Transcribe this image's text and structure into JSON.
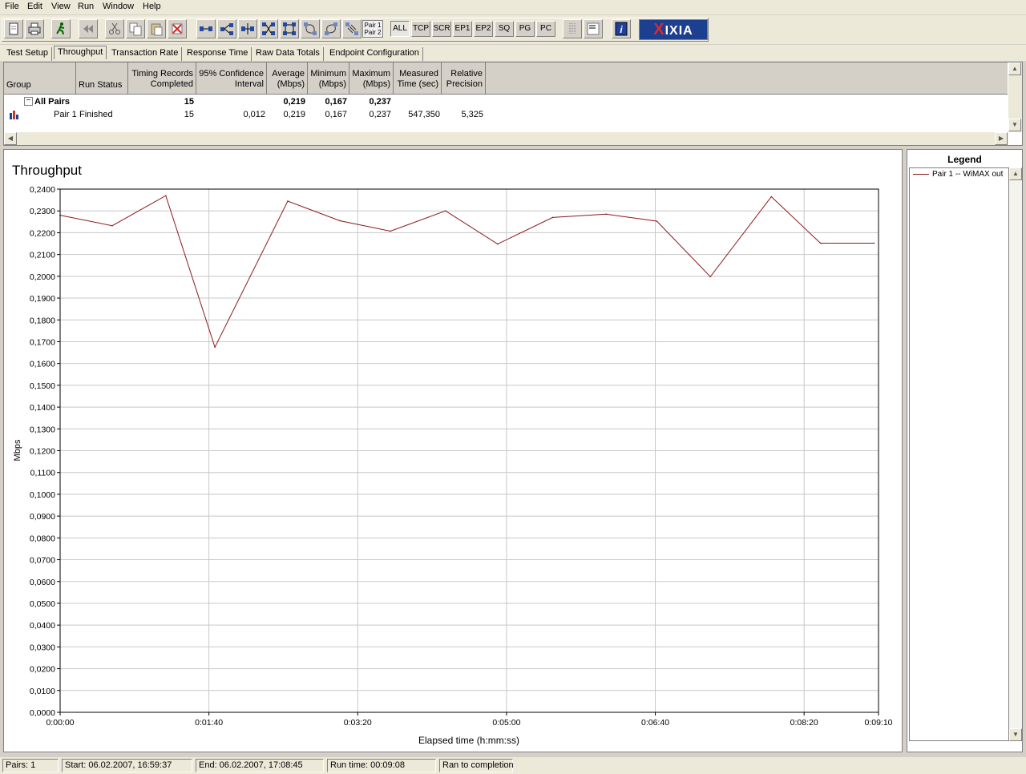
{
  "menu": [
    "File",
    "Edit",
    "View",
    "Run",
    "Window",
    "Help"
  ],
  "toolbar": {
    "text_buttons": [
      "ALL",
      "TCP",
      "SCR",
      "EP1",
      "EP2",
      "SQ",
      "PG",
      "PC"
    ],
    "pair_button": [
      "Pair 1",
      "Pair 2"
    ],
    "logo_text": "IXIA",
    "logo_mark": "X"
  },
  "tabs": [
    "Test Setup",
    "Throughput",
    "Transaction Rate",
    "Response Time",
    "Raw Data Totals",
    "Endpoint Configuration"
  ],
  "active_tab": "Throughput",
  "grid": {
    "headers": [
      {
        "key": "group",
        "label": "Group"
      },
      {
        "key": "run_status",
        "label": "Run Status"
      },
      {
        "key": "records",
        "label": "Timing Records Completed"
      },
      {
        "key": "ci",
        "label": "95% Confidence Interval"
      },
      {
        "key": "avg",
        "label": "Average (Mbps)"
      },
      {
        "key": "min",
        "label": "Minimum (Mbps)"
      },
      {
        "key": "max",
        "label": "Maximum (Mbps)"
      },
      {
        "key": "time",
        "label": "Measured Time (sec)"
      },
      {
        "key": "precision",
        "label": "Relative Precision"
      }
    ],
    "rows": [
      {
        "expander": "−",
        "group": "All Pairs",
        "run_status": "",
        "records": "15",
        "ci": "",
        "avg": "0,219",
        "min": "0,167",
        "max": "0,237",
        "time": "",
        "precision": ""
      },
      {
        "group": "Pair 1",
        "run_status": "Finished",
        "records": "15",
        "ci": "0,012",
        "avg": "0,219",
        "min": "0,167",
        "max": "0,237",
        "time": "547,350",
        "precision": "5,325"
      }
    ]
  },
  "chart_data": {
    "type": "line",
    "title": "Throughput",
    "xlabel": "Elapsed time (h:mm:ss)",
    "ylabel": "Mbps",
    "xlim": [
      0,
      550
    ],
    "ylim": [
      0,
      0.24
    ],
    "grid": true,
    "legend_position": "right panel",
    "x_ticks": [
      {
        "v": 0,
        "label": "0:00:00"
      },
      {
        "v": 100,
        "label": "0:01:40"
      },
      {
        "v": 200,
        "label": "0:03:20"
      },
      {
        "v": 300,
        "label": "0:05:00"
      },
      {
        "v": 400,
        "label": "0:06:40"
      },
      {
        "v": 500,
        "label": "0:08:20"
      },
      {
        "v": 550,
        "label": "0:09:10"
      }
    ],
    "y_ticks": [
      "0,0000",
      "0,0100",
      "0,0200",
      "0,0300",
      "0,0400",
      "0,0500",
      "0,0600",
      "0,0700",
      "0,0800",
      "0,0900",
      "0,1000",
      "0,1100",
      "0,1200",
      "0,1300",
      "0,1400",
      "0,1500",
      "0,1600",
      "0,1700",
      "0,1800",
      "0,1900",
      "0,2000",
      "0,2100",
      "0,2200",
      "0,2300",
      "0,2400"
    ],
    "series": [
      {
        "name": "Pair 1 -- WiMAX out",
        "color": "#8b1a1a",
        "x": [
          0,
          35,
          71,
          104,
          153,
          188,
          222,
          259,
          294,
          331,
          367,
          401,
          437,
          478,
          511,
          547
        ],
        "y": [
          0.228,
          0.2232,
          0.237,
          0.1675,
          0.2345,
          0.2255,
          0.2207,
          0.23,
          0.2148,
          0.227,
          0.2285,
          0.2253,
          0.1998,
          0.2365,
          0.2152,
          0.2152
        ]
      }
    ]
  },
  "legend": {
    "title": "Legend"
  },
  "status": {
    "pairs": "Pairs: 1",
    "start": "Start: 06.02.2007, 16:59:37",
    "end": "End: 06.02.2007, 17:08:45",
    "runtime": "Run time: 00:09:08",
    "state": "Ran to completion"
  }
}
